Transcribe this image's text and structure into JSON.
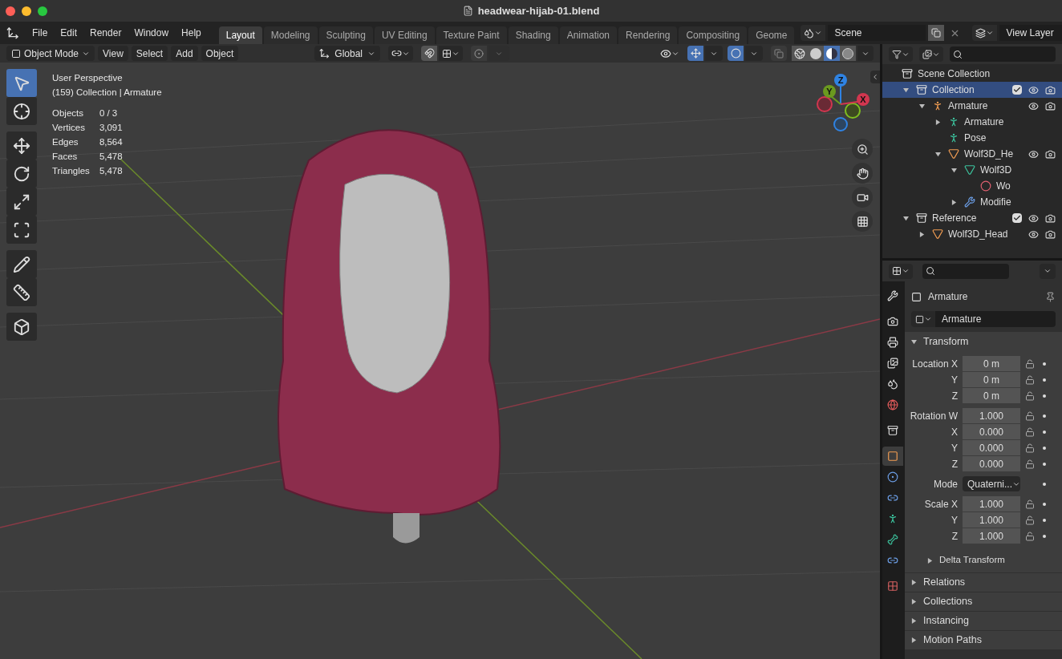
{
  "window": {
    "title": "headwear-hijab-01.blend"
  },
  "menu": [
    "File",
    "Edit",
    "Render",
    "Window",
    "Help"
  ],
  "workspaces": [
    {
      "label": "Layout",
      "selected": true
    },
    {
      "label": "Modeling",
      "selected": false
    },
    {
      "label": "Sculpting",
      "selected": false
    },
    {
      "label": "UV Editing",
      "selected": false
    },
    {
      "label": "Texture Paint",
      "selected": false
    },
    {
      "label": "Shading",
      "selected": false
    },
    {
      "label": "Animation",
      "selected": false
    },
    {
      "label": "Rendering",
      "selected": false
    },
    {
      "label": "Compositing",
      "selected": false
    },
    {
      "label": "Geome",
      "selected": false
    }
  ],
  "scene": {
    "value": "Scene"
  },
  "view_layer": {
    "value": "View Layer"
  },
  "viewport_header": {
    "mode": "Object Mode",
    "menus": [
      "View",
      "Select",
      "Add",
      "Object"
    ],
    "orientation": "Global",
    "snap_on": false,
    "proportional_on": false,
    "gizmos_on": true,
    "overlays_on": true,
    "xray_on": false,
    "shading": [
      {
        "kind": "wireframe",
        "selected": false
      },
      {
        "kind": "solid",
        "selected": false
      },
      {
        "kind": "material",
        "selected": true
      },
      {
        "kind": "rendered",
        "selected": false
      }
    ]
  },
  "tool_groups": [
    {
      "tools": [
        {
          "kind": "select",
          "selected": true
        },
        {
          "kind": "cursor",
          "selected": false
        }
      ]
    },
    {
      "tools": [
        {
          "kind": "move",
          "selected": false
        },
        {
          "kind": "rotate",
          "selected": false
        },
        {
          "kind": "scale",
          "selected": false
        },
        {
          "kind": "transform",
          "selected": false
        }
      ]
    },
    {
      "tools": [
        {
          "kind": "annotate",
          "selected": false
        },
        {
          "kind": "measure",
          "selected": false
        }
      ]
    },
    {
      "tools": [
        {
          "kind": "add-cube",
          "selected": false
        }
      ]
    }
  ],
  "viewport_info": {
    "view": "User Perspective",
    "context": "(159) Collection | Armature",
    "stats": [
      {
        "label": "Objects",
        "value": "0 / 3"
      },
      {
        "label": "Vertices",
        "value": "3,091"
      },
      {
        "label": "Edges",
        "value": "8,564"
      },
      {
        "label": "Faces",
        "value": "5,478"
      },
      {
        "label": "Triangles",
        "value": "5,478"
      }
    ]
  },
  "gizmo": {
    "axes": [
      {
        "label": "Z",
        "color": "#2f83e3"
      },
      {
        "label": "Y",
        "color": "#6b9a1f"
      },
      {
        "label": "X",
        "color": "#d2364f"
      }
    ]
  },
  "outliner": {
    "root": "Scene Collection",
    "items": [
      {
        "label": "Collection",
        "kind": "collection",
        "selected": true,
        "expanded": true,
        "checked": true,
        "visible": true,
        "children": [
          {
            "label": "Armature",
            "kind": "armature-object",
            "selected": false,
            "expanded": true,
            "visible": true,
            "children": [
              {
                "label": "Armature",
                "kind": "armature-data",
                "selected": false,
                "expanded": false
              },
              {
                "label": "Pose",
                "kind": "pose",
                "selected": false
              },
              {
                "label": "Wolf3D_He",
                "kind": "mesh-object",
                "selected": false,
                "expanded": true,
                "visible": true,
                "children": [
                  {
                    "label": "Wolf3D",
                    "kind": "mesh-data",
                    "selected": false,
                    "expanded": true,
                    "children": [
                      {
                        "label": "Wo",
                        "kind": "material",
                        "selected": false
                      }
                    ]
                  },
                  {
                    "label": "Modifie",
                    "kind": "modifier",
                    "selected": false,
                    "expanded": false
                  }
                ]
              }
            ]
          }
        ]
      },
      {
        "label": "Reference",
        "kind": "collection",
        "selected": false,
        "expanded": true,
        "checked": true,
        "visible": true,
        "children": [
          {
            "label": "Wolf3D_Head",
            "kind": "mesh-object",
            "selected": false,
            "expanded": false,
            "visible": true
          }
        ]
      }
    ]
  },
  "properties": {
    "tab_groups": [
      [
        {
          "kind": "tool",
          "selected": false
        }
      ],
      [
        {
          "kind": "render",
          "selected": false
        },
        {
          "kind": "output",
          "selected": false
        },
        {
          "kind": "view-layer",
          "selected": false
        },
        {
          "kind": "scene",
          "selected": false
        },
        {
          "kind": "world",
          "selected": false
        }
      ],
      [
        {
          "kind": "collection",
          "selected": false
        }
      ],
      [
        {
          "kind": "object",
          "selected": true
        },
        {
          "kind": "physics",
          "selected": false
        },
        {
          "kind": "constraints",
          "selected": false
        },
        {
          "kind": "armature",
          "selected": false
        },
        {
          "kind": "bone",
          "selected": false
        },
        {
          "kind": "bone-constraints",
          "selected": false
        }
      ],
      [
        {
          "kind": "texture",
          "selected": false
        }
      ]
    ],
    "object_name": "Armature",
    "name_field": "Armature",
    "transform": {
      "title": "Transform",
      "expanded": true,
      "groups": [
        [
          {
            "label": "Location X",
            "value": "0 m",
            "kind": "number"
          },
          {
            "label": "Y",
            "value": "0 m",
            "kind": "number"
          },
          {
            "label": "Z",
            "value": "0 m",
            "kind": "number"
          }
        ],
        [
          {
            "label": "Rotation W",
            "value": "1.000",
            "kind": "number"
          },
          {
            "label": "X",
            "value": "0.000",
            "kind": "number"
          },
          {
            "label": "Y",
            "value": "0.000",
            "kind": "number"
          },
          {
            "label": "Z",
            "value": "0.000",
            "kind": "number"
          }
        ],
        [
          {
            "label": "Mode",
            "value": "Quaterni...",
            "kind": "dropdown"
          }
        ],
        [
          {
            "label": "Scale X",
            "value": "1.000",
            "kind": "number"
          },
          {
            "label": "Y",
            "value": "1.000",
            "kind": "number"
          },
          {
            "label": "Z",
            "value": "1.000",
            "kind": "number"
          }
        ]
      ],
      "subpanel": {
        "title": "Delta Transform",
        "expanded": false
      }
    },
    "panels": [
      {
        "title": "Relations",
        "expanded": false
      },
      {
        "title": "Collections",
        "expanded": false
      },
      {
        "title": "Instancing",
        "expanded": false
      },
      {
        "title": "Motion Paths",
        "expanded": false
      }
    ]
  }
}
